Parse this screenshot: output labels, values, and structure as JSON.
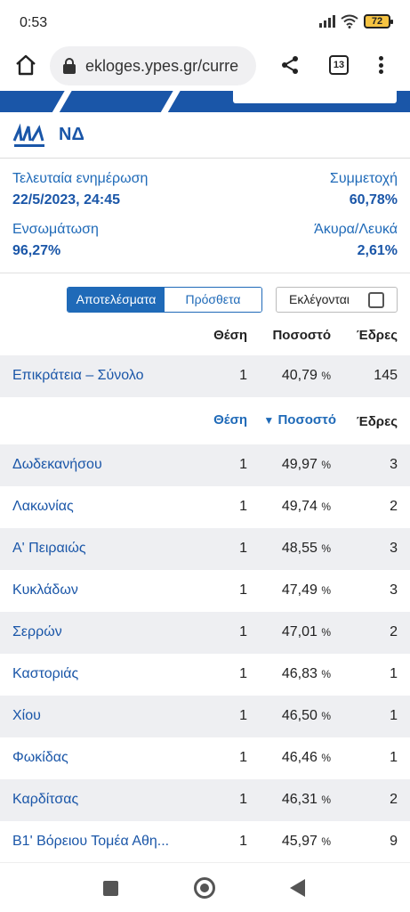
{
  "status_bar": {
    "time": "0:53",
    "battery": "72"
  },
  "browser": {
    "url": "ekloges.ypes.gr/curre",
    "tab_count": "13"
  },
  "party": {
    "name": "ΝΔ"
  },
  "info": {
    "last_update_label": "Τελευταία ενημέρωση",
    "last_update_value": "22/5/2023, 24:45",
    "turnout_label": "Συμμετοχή",
    "turnout_value": "60,78%",
    "integration_label": "Ενσωμάτωση",
    "integration_value": "96,27%",
    "invalid_label": "Άκυρα/Λευκά",
    "invalid_value": "2,61%"
  },
  "toggle": {
    "results": "Αποτελέσματα",
    "extras": "Πρόσθετα",
    "elected": "Εκλέγονται"
  },
  "columns": {
    "position": "Θέση",
    "percent": "Ποσοστό",
    "seats": "Έδρες",
    "sorted_indicator": "▼"
  },
  "summary": {
    "name": "Επικράτεια – Σύνολο",
    "position": "1",
    "percent": "40,79",
    "unit": "%",
    "seats": "145"
  },
  "rows": [
    {
      "name": "Δωδεκανήσου",
      "position": "1",
      "percent": "49,97",
      "seats": "3"
    },
    {
      "name": "Λακωνίας",
      "position": "1",
      "percent": "49,74",
      "seats": "2"
    },
    {
      "name": "Α' Πειραιώς",
      "position": "1",
      "percent": "48,55",
      "seats": "3"
    },
    {
      "name": "Κυκλάδων",
      "position": "1",
      "percent": "47,49",
      "seats": "3"
    },
    {
      "name": "Σερρών",
      "position": "1",
      "percent": "47,01",
      "seats": "2"
    },
    {
      "name": "Καστοριάς",
      "position": "1",
      "percent": "46,83",
      "seats": "1"
    },
    {
      "name": "Χίου",
      "position": "1",
      "percent": "46,50",
      "seats": "1"
    },
    {
      "name": "Φωκίδας",
      "position": "1",
      "percent": "46,46",
      "seats": "1"
    },
    {
      "name": "Καρδίτσας",
      "position": "1",
      "percent": "46,31",
      "seats": "2"
    },
    {
      "name": "Β1' Βόρειου Τομέα Αθη...",
      "position": "1",
      "percent": "45,97",
      "seats": "9"
    }
  ],
  "colors": {
    "primary_blue": "#1f6ab8",
    "dark_blue": "#1a56a8",
    "row_gray": "#eeeff2",
    "battery": "#f5c342"
  }
}
